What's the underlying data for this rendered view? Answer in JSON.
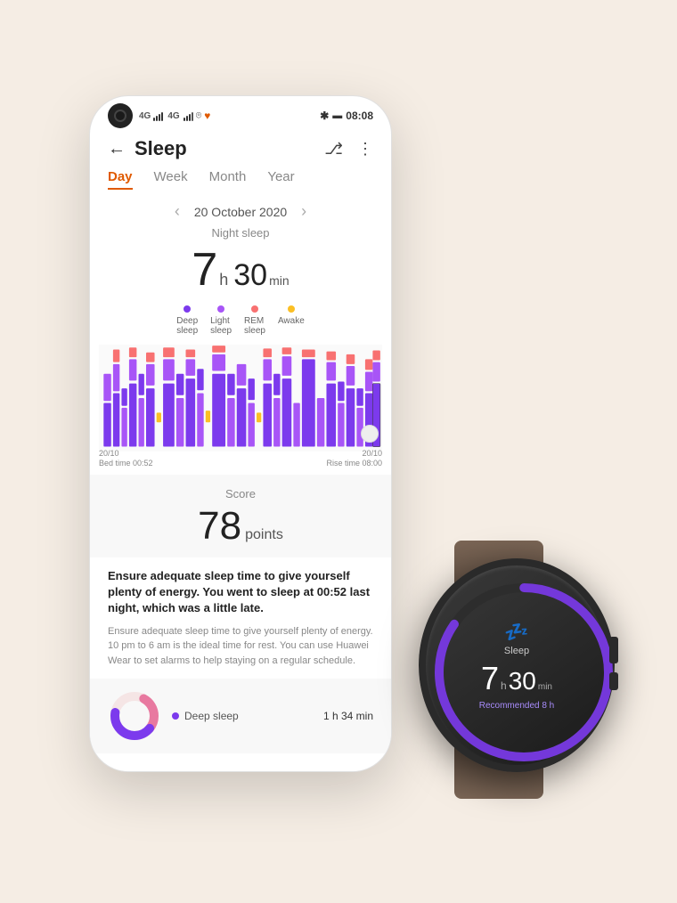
{
  "status_bar": {
    "time": "08:08",
    "battery_icon": "🔋",
    "bluetooth": "✱"
  },
  "header": {
    "back_label": "←",
    "title": "Sleep",
    "share_icon": "share",
    "more_icon": "⋮"
  },
  "tabs": [
    {
      "label": "Day",
      "active": true
    },
    {
      "label": "Week",
      "active": false
    },
    {
      "label": "Month",
      "active": false
    },
    {
      "label": "Year",
      "active": false
    }
  ],
  "date": {
    "prev_arrow": "‹",
    "next_arrow": "›",
    "value": "20 October 2020"
  },
  "sleep": {
    "section_label": "Night sleep",
    "hours": "7",
    "hours_unit": "h",
    "minutes": "30",
    "minutes_unit": "min"
  },
  "legend": [
    {
      "label": "Deep sleep",
      "color": "#7c3aed"
    },
    {
      "label": "Light sleep",
      "color": "#a855f7"
    },
    {
      "label": "REM sleep",
      "color": "#f87171"
    },
    {
      "label": "Awake",
      "color": "#fbbf24"
    }
  ],
  "chart": {
    "annotation_left_date": "20/10",
    "annotation_left_time": "Bed time 00:52",
    "annotation_right_date": "20/10",
    "annotation_right_time": "Rise time 08:00"
  },
  "score": {
    "label": "Score",
    "value": "78",
    "unit": "points"
  },
  "analysis": {
    "bold_text": "Ensure adequate sleep time to give yourself plenty of energy. You went to sleep at 00:52 last night, which was a little late.",
    "normal_text": "Ensure adequate sleep time to give yourself plenty of energy. 10 pm to 6 am is the ideal time for rest. You can use Huawei Wear to set alarms to help staying on a regular schedule."
  },
  "breakdown": {
    "items": [
      {
        "label": "Deep sleep",
        "color": "#7c3aed",
        "value": "1 h 34 min"
      }
    ]
  },
  "watch": {
    "sleep_icon": "💤",
    "label": "Sleep",
    "hours": "7",
    "h_unit": "h",
    "minutes": "30",
    "min_unit": "min",
    "recommended_text": "Recommended",
    "recommended_hours": "8 h",
    "arc_color": "#7c3aed",
    "arc_bg_color": "#2a2a2a"
  }
}
